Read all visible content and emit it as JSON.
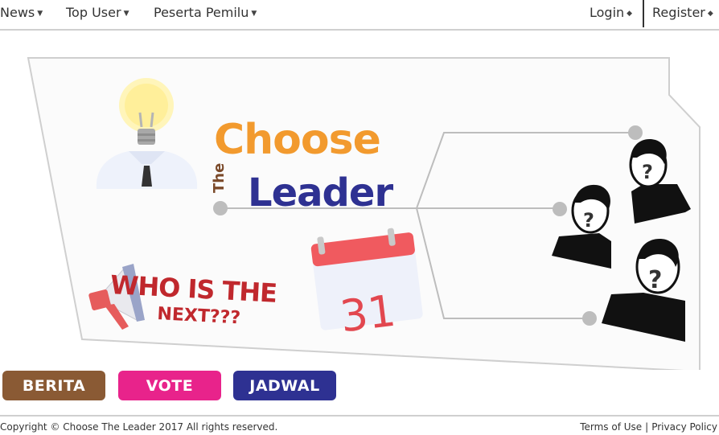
{
  "nav": {
    "news": "News",
    "top_user": "Top User",
    "peserta": "Peserta Pemilu",
    "login": "Login",
    "register": "Register"
  },
  "hero": {
    "title_choose": "Choose",
    "title_the": "The",
    "title_leader": "Leader",
    "tagline_line1": "WHO IS THE",
    "tagline_line2": "NEXT???",
    "calendar_day": "31",
    "colors": {
      "choose": "#f29a2e",
      "leader": "#2e3192",
      "the": "#7b4a2a",
      "tagline": "#c0282d"
    }
  },
  "buttons": {
    "berita": "BERITA",
    "vote": "VOTE",
    "jadwal": "JADWAL"
  },
  "footer": {
    "copyright": "Copyright © Choose The Leader 2017 All rights reserved.",
    "terms": "Terms of Use",
    "separator": "|",
    "privacy": "Privacy Policy"
  },
  "icons": [
    "caret-down-icon",
    "caret-down-icon",
    "caret-down-icon",
    "diamond-arrow-icon",
    "diamond-arrow-icon",
    "lightbulb-icon",
    "megaphone-icon",
    "calendar-icon",
    "person-question-icon"
  ]
}
